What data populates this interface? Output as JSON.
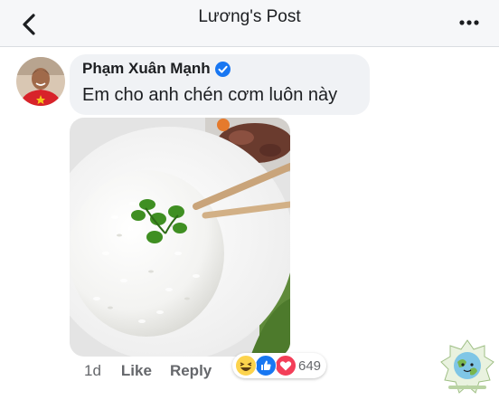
{
  "header": {
    "title": "Lương's Post",
    "back_icon": "chevron-left-icon",
    "more_icon": "more-horizontal-icon"
  },
  "comment": {
    "author": "Phạm Xuân Mạnh",
    "verified": true,
    "text": "Em cho anh chén cơm luôn này",
    "image_description": "bowl-of-rice-with-chopsticks",
    "time": "1d",
    "like_label": "Like",
    "reply_label": "Reply",
    "reactions": {
      "icons": [
        "haha-reaction-icon",
        "like-reaction-icon",
        "love-reaction-icon"
      ],
      "count": "649"
    }
  },
  "colors": {
    "header_bg": "#f6f7f9",
    "bubble_bg": "#f0f2f5",
    "verified_blue": "#1877f2",
    "love_red": "#f33e58",
    "haha_yellow": "#fcd34d"
  }
}
